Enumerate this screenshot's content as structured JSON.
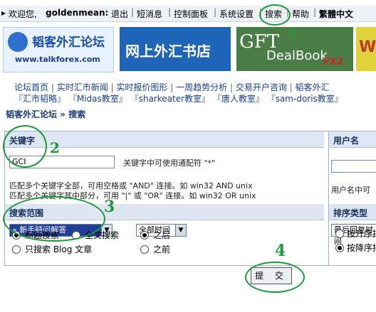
{
  "topbar": {
    "welcome": "欢迎您,",
    "username": "goldenmean:",
    "logout": "退出",
    "messages": "短消息",
    "control_panel": "控制面板",
    "settings": "系统设置",
    "search": "搜索",
    "help": "帮助",
    "traditional": "繁體中文"
  },
  "banners": {
    "forum_name": "韬客外汇论坛",
    "forum_url": "www.talkforex.com",
    "bookstore": "网上外汇书店",
    "gft_title": "GFT",
    "gft_sub": "DealBook",
    "gft_fx": "FX2",
    "fourth": "W"
  },
  "links_row1": [
    "论坛首页",
    "实时汇市新闻",
    "实时报价图形",
    "一周趋势分析",
    "交易开户咨询",
    "韬客外汇"
  ],
  "links_row2": [
    "『汇市韬略』",
    "『Midas教室』",
    "『sharkeater教室』",
    "『唐人教室』",
    "『sam-doris教室』"
  ],
  "breadcrumb": "韬客外汇论坛 » 搜索",
  "form": {
    "keyword_header": "关键字",
    "username_header": "用户名",
    "keyword_value": "GCI",
    "wildcard_note": "关键字中可使用通配符 \"*\"",
    "and_note": "匹配多个关键字全部，可用空格或 \"AND\" 连接。如 win32 AND unix",
    "or_note": "匹配多个关键字其中部分，可用 \"|\" 或 \"OR\" 连接。如 win32 OR unix",
    "username_note": "用户名中可",
    "scope_header": "搜索范围",
    "sort_header": "排序类型",
    "forum_select": "» 新手疑问解答",
    "time_select": "全部时间",
    "sort_select": "最后回复时间",
    "radio_title": "标题搜索",
    "radio_fulltext": "全文搜索",
    "radio_after": "之后",
    "radio_before": "之前",
    "radio_blog": "只搜索 Blog 文章",
    "radio_sort_asc": "按升序排",
    "radio_sort_desc": "按降序排",
    "submit": "提 交"
  },
  "annotations": {
    "mark1": "1",
    "mark2": "2",
    "mark3": "3",
    "mark4": "4"
  },
  "colors": {
    "annotation": "#1e9a3a",
    "link": "#1a3f8f",
    "header_bg": "#dde6f2"
  }
}
